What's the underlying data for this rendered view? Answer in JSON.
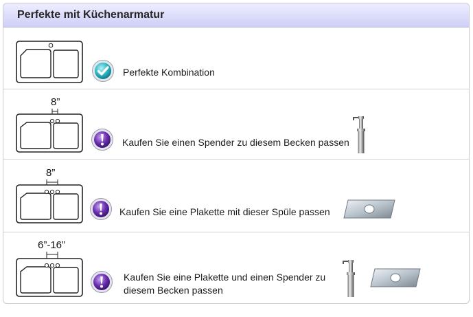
{
  "header": {
    "title": "Perfekte mit Küchenarmatur"
  },
  "rows": [
    {
      "text": "Perfekte Kombination",
      "status_icon": "check-icon"
    },
    {
      "dimension": "8”",
      "text": "Kaufen Sie einen Spender zu diesem Becken passen",
      "status_icon": "exclamation-icon",
      "product_icons": [
        "soap-dispenser-icon"
      ]
    },
    {
      "dimension": "8”",
      "text": "Kaufen Sie  eine Plakette mit dieser Spüle passen",
      "status_icon": "exclamation-icon",
      "product_icons": [
        "deck-plate-icon"
      ]
    },
    {
      "dimension": "6”-16”",
      "text_line1": "Kaufen Sie eine Plakette und einen Spender zu",
      "text_line2": "diesem Becken passen",
      "status_icon": "exclamation-icon",
      "product_icons": [
        "soap-dispenser-icon",
        "deck-plate-icon"
      ]
    }
  ],
  "colors": {
    "header_bg": "#dcdcfb",
    "check_accent": "#2eb8c8",
    "alert_accent": "#6a2fb0"
  }
}
